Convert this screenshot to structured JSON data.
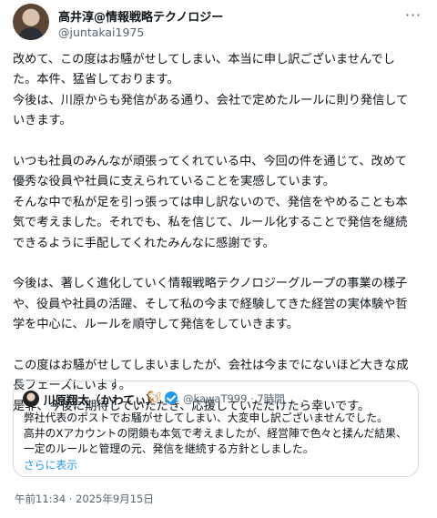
{
  "author": {
    "name": "高井淳@情報戦略テクノロジー",
    "handle": "@juntakai1975",
    "avatar_icon": "user-avatar-icon",
    "more_label": "···"
  },
  "body": {
    "paragraphs": [
      [
        "改めて、この度はお騒がせしてしまい、本当に申し訳ございませんでし",
        "た。本件、猛省しております。",
        " 今後は、川原からも発信がある通り、会社で定めたルールに則り発信して",
        "いきます。"
      ],
      [
        " いつも社員のみんなが頑張ってくれている中、今回の件を通じて、改めて",
        "優秀な役員や社員に支えられていることを実感しています。",
        " そんな中で私が足を引っ張っては申し訳ないので、発信をやめることも本",
        "気で考えました。それでも、私を信じて、ルール化することで発信を継続",
        "できるように手配してくれたみんなに感謝です。"
      ],
      [
        " 今後は、著しく進化していく情報戦略テクノロジーグループの事業の様子",
        "や、役員や社員の活躍、そして私の今まで経験してきた経営の実体験や哲",
        "学を中心に、ルールを順守して発信をしていきます。"
      ],
      [
        " この度はお騒がせしてしまいましたが、会社は今までにないほど大きな成",
        "長フェーズにいます。",
        " 是非、今後に期待していただき、応援していただけたら幸いです。"
      ]
    ]
  },
  "quote": {
    "name": "川原翔太（かわてぃ）",
    "emoji": "🐿",
    "verified_icon": "verified-badge-icon",
    "handle": "@kawaT999",
    "separator": "·",
    "time": "7時間",
    "lines": [
      "弊社代表のポストでお騒がせしてしまい、大変申し訳ございませんでした。",
      "高井のXアカウントの閉鎖も本気で考えましたが、経営陣で色々と揉んだ結果、",
      "一定のルールと管理の元、発信を継続する方針としました。"
    ],
    "show_more": "さらに表示"
  },
  "timestamp": "午前11:34 · 2025年9月15日",
  "colors": {
    "text": "#0f1419",
    "secondary": "#536471",
    "accent": "#1d9bf0",
    "border": "#cfd9de"
  }
}
